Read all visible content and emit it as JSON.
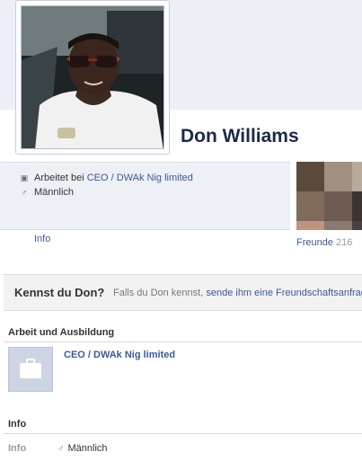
{
  "profile": {
    "name": "Don Williams"
  },
  "basic_info": {
    "work_prefix": "Arbeitet bei",
    "work_link": "CEO / DWAk Nig limited",
    "gender": "Männlich",
    "work_icon": "briefcase-icon",
    "gender_icon": "male-icon"
  },
  "tabs": {
    "info": "Info"
  },
  "friends": {
    "label": "Freunde",
    "count": "216"
  },
  "know_box": {
    "title": "Kennst du Don?",
    "prefix": "Falls du Don kennst,",
    "link": "sende ihm eine Freundschaftsanfrage"
  },
  "work_section": {
    "heading": "Arbeit und Ausbildung",
    "employer": "CEO / DWAk Nig limited"
  },
  "info_section": {
    "heading": "Info",
    "key": "Info",
    "gender": "Männlich"
  },
  "colors": {
    "link": "#3b5998",
    "name": "#1c2a47",
    "panel": "#edf0f5"
  }
}
